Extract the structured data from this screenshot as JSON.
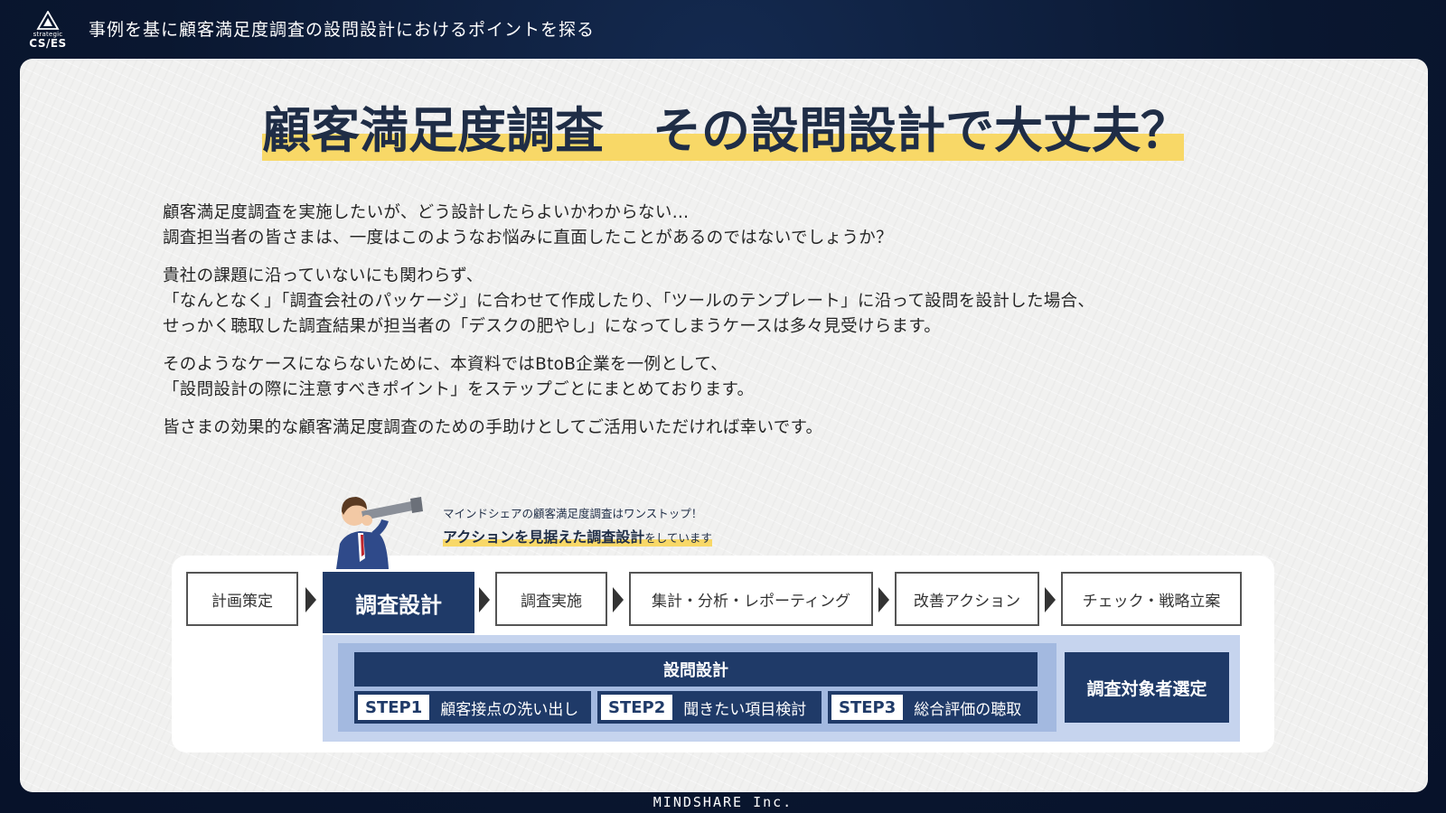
{
  "header": {
    "logo_small": "strategic",
    "logo_big": "CS/ES",
    "title": "事例を基に顧客満足度調査の設問設計におけるポイントを探る"
  },
  "main": {
    "title": "顧客満足度調査　その設問設計で大丈夫？",
    "paragraphs": [
      [
        "顧客満足度調査を実施したいが、どう設計したらよいかわからない…",
        "調査担当者の皆さまは、一度はこのようなお悩みに直面したことがあるのではないでしょうか？"
      ],
      [
        "貴社の課題に沿っていないにも関わらず、",
        "「なんとなく」「調査会社のパッケージ」に合わせて作成したり、「ツールのテンプレート」に沿って設問を設計した場合、",
        "せっかく聴取した調査結果が担当者の「デスクの肥やし」になってしまうケースは多々見受けらます。"
      ],
      [
        "そのようなケースにならないために、本資料ではBtoB企業を一例として、",
        "「設問設計の際に注意すべきポイント」をステップごとにまとめております。"
      ],
      [
        "皆さまの効果的な顧客満足度調査のための手助けとしてご活用いただければ幸いです。"
      ]
    ]
  },
  "callout": {
    "line1": "マインドシェアの顧客満足度調査はワンストップ！",
    "line2_strong": "アクションを見据えた調査設計",
    "line2_tail": "をしています"
  },
  "flow": {
    "steps": [
      "計画策定",
      "調査設計",
      "調査実施",
      "集計・分析・レポーティング",
      "改善アクション",
      "チェック・戦略立案"
    ],
    "detail_title": "設問設計",
    "sub_steps": [
      {
        "badge": "STEP1",
        "label": "顧客接点の洗い出し"
      },
      {
        "badge": "STEP2",
        "label": "聞きたい項目検討"
      },
      {
        "badge": "STEP3",
        "label": "総合評価の聴取"
      }
    ],
    "target": "調査対象者選定"
  },
  "footer": {
    "company": "MINDSHARE Inc."
  },
  "colors": {
    "navy": "#1f3a68",
    "highlight": "#f8d867",
    "background": "#0c1a33"
  }
}
